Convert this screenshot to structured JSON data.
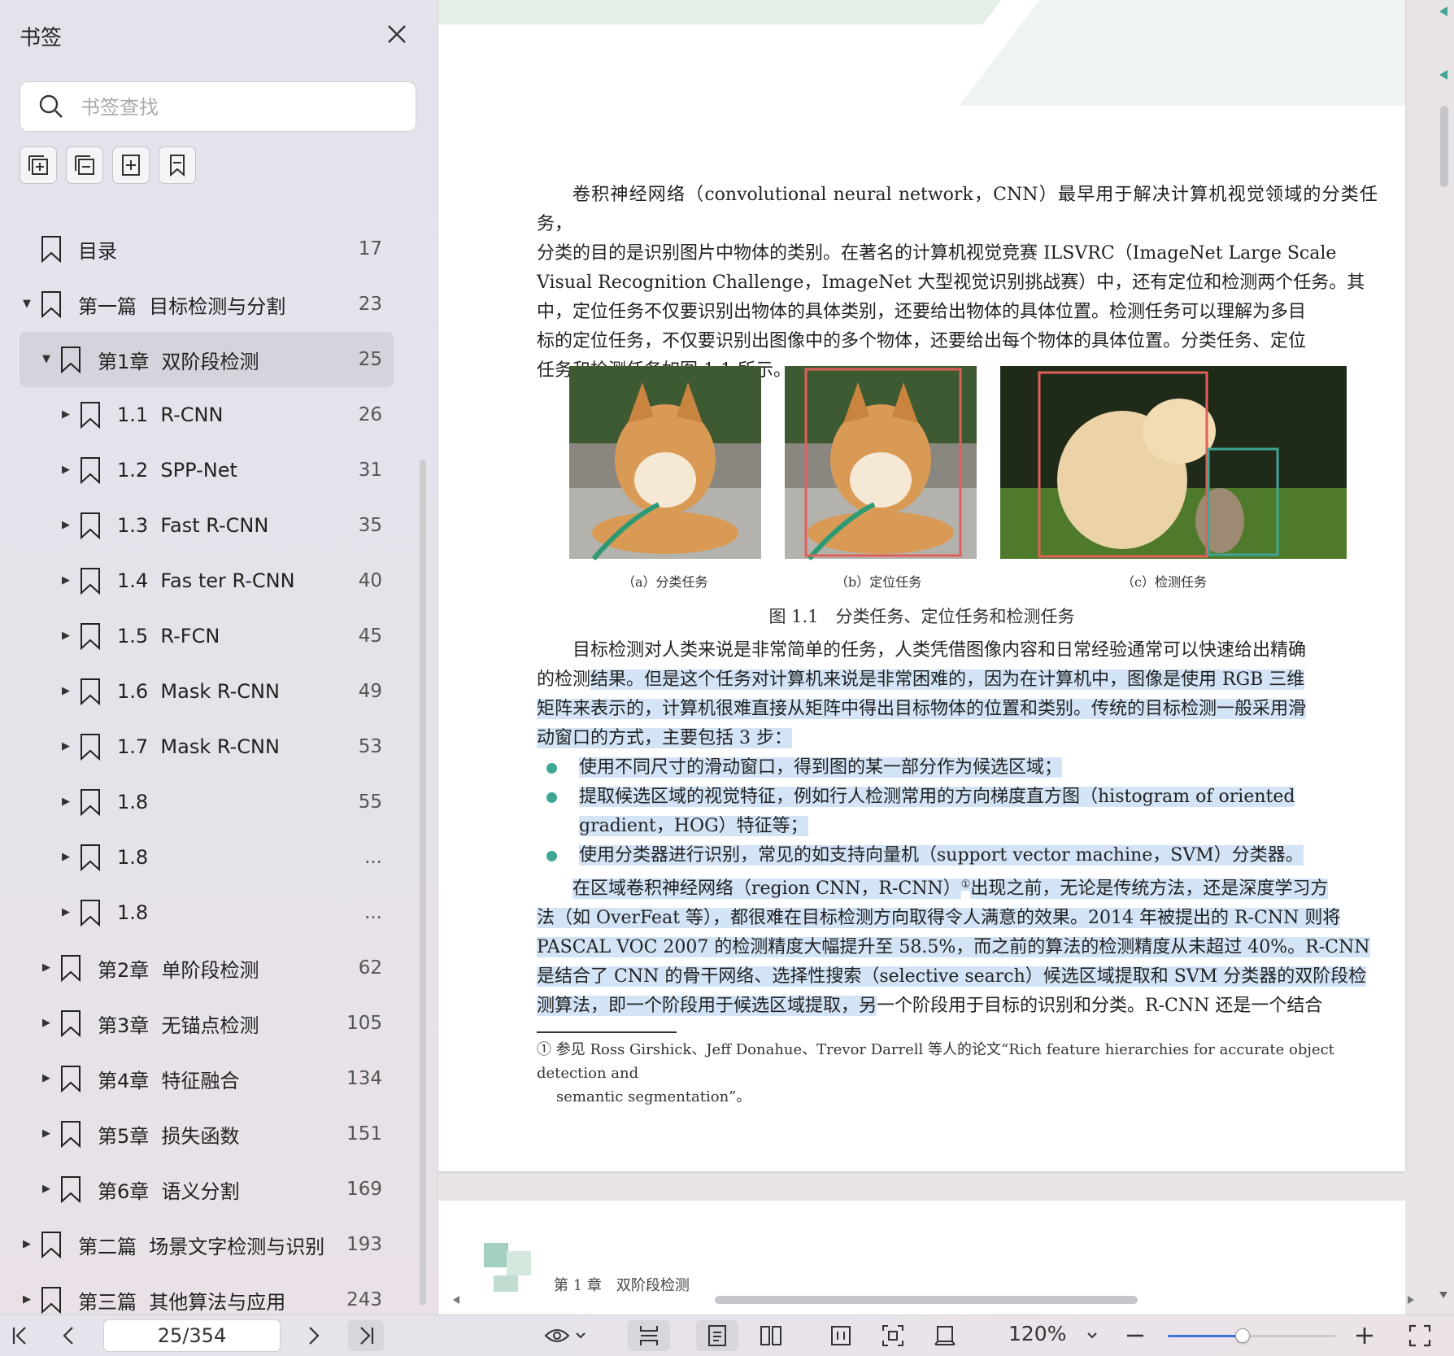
{
  "sidebar": {
    "title": "书签",
    "search_placeholder": "书签查找",
    "bookmarks": [
      {
        "label": "目录",
        "page": "17",
        "level": 0,
        "caret": "",
        "active": false
      },
      {
        "label": "第一篇  目标检测与分割",
        "page": "23",
        "level": 0,
        "caret": "down",
        "active": false
      },
      {
        "label": "第1章  双阶段检测",
        "page": "25",
        "level": 1,
        "caret": "down",
        "active": true
      },
      {
        "label": "1.1  R-CNN",
        "page": "26",
        "level": 2,
        "caret": "right",
        "active": false
      },
      {
        "label": "1.2  SPP-Net",
        "page": "31",
        "level": 2,
        "caret": "right",
        "active": false
      },
      {
        "label": "1.3  Fast R-CNN",
        "page": "35",
        "level": 2,
        "caret": "right",
        "active": false
      },
      {
        "label": "1.4  Fas ter R-CNN",
        "page": "40",
        "level": 2,
        "caret": "right",
        "active": false
      },
      {
        "label": "1.5  R-FCN",
        "page": "45",
        "level": 2,
        "caret": "right",
        "active": false
      },
      {
        "label": "1.6  Mask R-CNN",
        "page": "49",
        "level": 2,
        "caret": "right",
        "active": false
      },
      {
        "label": "1.7  Mask R-CNN",
        "page": "53",
        "level": 2,
        "caret": "right",
        "active": false
      },
      {
        "label": "1.8",
        "page": "55",
        "level": 2,
        "caret": "right",
        "active": false
      },
      {
        "label": "1.8",
        "page": "...",
        "level": 2,
        "caret": "right",
        "active": false
      },
      {
        "label": "1.8",
        "page": "...",
        "level": 2,
        "caret": "right",
        "active": false
      },
      {
        "label": "第2章  单阶段检测",
        "page": "62",
        "level": 1,
        "caret": "right",
        "active": false
      },
      {
        "label": "第3章  无锚点检测",
        "page": "105",
        "level": 1,
        "caret": "right",
        "active": false
      },
      {
        "label": "第4章  特征融合",
        "page": "134",
        "level": 1,
        "caret": "right",
        "active": false
      },
      {
        "label": "第5章  损失函数",
        "page": "151",
        "level": 1,
        "caret": "right",
        "active": false
      },
      {
        "label": "第6章  语义分割",
        "page": "169",
        "level": 1,
        "caret": "right",
        "active": false
      },
      {
        "label": "第二篇  场景文字检测与识别",
        "page": "193",
        "level": 0,
        "caret": "right",
        "active": false
      },
      {
        "label": "第三篇  其他算法与应用",
        "page": "243",
        "level": 0,
        "caret": "right",
        "active": false
      }
    ]
  },
  "document": {
    "para1_lines": [
      "卷积神经网络（convolutional neural network，CNN）最早用于解决计算机视觉领域的分类任务，",
      "分类的目的是识别图片中物体的类别。在著名的计算机视觉竞赛 ILSVRC（ImageNet Large Scale",
      "Visual Recognition Challenge，ImageNet 大型视觉识别挑战赛）中，还有定位和检测两个任务。其",
      "中，定位任务不仅要识别出物体的具体类别，还要给出物体的具体位置。检测任务可以理解为多目",
      "标的定位任务，不仅要识别出图像中的多个物体，还要给出每个物体的具体位置。分类任务、定位",
      "任务和检测任务如图 1.1 所示。"
    ],
    "fig_sub_a": "（a）分类任务",
    "fig_sub_b": "（b）定位任务",
    "fig_sub_c": "（c）检测任务",
    "fig_caption": "图 1.1　分类任务、定位任务和检测任务",
    "para2_line1_plain": "目标检测对人类来说是非常简单的任务，人类凭借图像内容和日常经验通常可以快速给出精确",
    "para2_line2_plain": "的检测",
    "para2_line2_hl": "结果。但是这个任务对计算机来说是非常困难的，因为在计算机中，图像是使用 RGB 三维",
    "para2_line3_hl": "矩阵来表示的，计算机很难直接从矩阵中得出目标物体的位置和类别。传统的目标检测一般采用滑",
    "para2_line4_hl": "动窗口的方式，主要包括 3 步：",
    "bullet1": "使用不同尺寸的滑动窗口，得到图的某一部分作为候选区域；",
    "bullet2_line1": "提取候选区域的视觉特征，例如行人检测常用的方向梯度直方图（histogram of oriented",
    "bullet2_line2": "gradient，HOG）特征等；",
    "bullet3": "使用分类器进行识别，常见的如支持向量机（support vector machine，SVM）分类器。",
    "para3_line1": "在区域卷积神经网络（region CNN，R-CNN）",
    "para3_sup": "①",
    "para3_line1_rest": "出现之前，无论是传统方法，还是深度学习方",
    "para3_line2": "法（如 OverFeat 等），都很难在目标检测方向取得令人满意的效果。2014 年被提出的 R-CNN 则将",
    "para3_line3": "PASCAL VOC 2007 的检测精度大幅提升至 58.5%，而之前的算法的检测精度从未超过 40%。R-CNN",
    "para3_line4": "是结合了 CNN 的骨干网络、选择性搜索（selective search）候选区域提取和 SVM 分类器的双阶段检",
    "para3_line5_hl": "测算法，即一个阶段用于候选区域提取，另",
    "para3_line5_plain": "一个阶段用于目标的识别和分类。R-CNN 还是一个结合",
    "footnote_line1": "① 参见 Ross Girshick、Jeff Donahue、Trevor Darrell 等人的论文“Rich feature hierarchies for accurate object detection and",
    "footnote_line2": "semantic segmentation”。",
    "page2_chapter": "第 1 章　双阶段检测"
  },
  "bottombar": {
    "page_indicator": "25/354",
    "zoom": "120%",
    "zoom_slider_fraction": 0.44
  },
  "colors": {
    "highlight": "#d3e4f6",
    "bullet_dot": "#3fa696",
    "accent": "#3a72e0",
    "bbox_red": "#e0605a",
    "bbox_teal": "#3fa696"
  }
}
